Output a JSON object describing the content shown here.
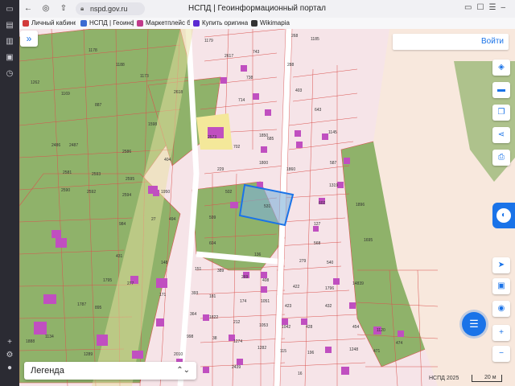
{
  "browser": {
    "url": "nspd.gov.ru",
    "page_title": "НСПД | Геоинформационный портал",
    "bookmarks": [
      {
        "label": "Личный кабинет",
        "color": "#d23a3a"
      },
      {
        "label": "НСПД | Геоинфор",
        "color": "#3a6ad2"
      },
      {
        "label": "Маркетплейс бра",
        "color": "#c03a8a"
      },
      {
        "label": "Купить оригинал",
        "color": "#5a2ad2"
      },
      {
        "label": "Wikimapia",
        "color": "#333333"
      }
    ]
  },
  "map": {
    "login_label": "Войти",
    "legend_label": "Легенда",
    "attribution": "НСПД 2025",
    "scale_label": "20 м",
    "selected_parcel_label": "531",
    "colors": {
      "parcel_fill": "#f6e4e8",
      "parcel_border": "#d9534f",
      "green_area": "#8fb26a",
      "building": "#c04fc0",
      "selected_border": "#1a73e8",
      "road": "#ffffff"
    },
    "parcel_labels": [
      "268",
      "1185",
      "1179",
      "2617",
      "743",
      "1178",
      "1188",
      "288",
      "1173",
      "738",
      "1262",
      "1169",
      "887",
      "2618",
      "403",
      "714",
      "643",
      "1598",
      "1850",
      "2573",
      "702",
      "685",
      "1145",
      "2486",
      "2487",
      "2586",
      "404",
      "1800",
      "1860",
      "587",
      "2581",
      "2593",
      "2590",
      "2592",
      "2595",
      "229",
      "1319",
      "2594",
      "1950",
      "502",
      "602",
      "27",
      "494",
      "599",
      "127",
      "1896",
      "984",
      "604",
      "568",
      "1695",
      "431",
      "136",
      "279",
      "540",
      "148",
      "151",
      "389",
      "269",
      "408",
      "422",
      "1796",
      "1795",
      "277",
      "171",
      "393",
      "181",
      "174",
      "1051",
      "423",
      "432",
      "14839",
      "1787",
      "895",
      "364",
      "1822",
      "212",
      "1053",
      "1042",
      "428",
      "454",
      "1120",
      "1134",
      "998",
      "38",
      "1274",
      "1282",
      "115",
      "196",
      "1248",
      "471",
      "474",
      "1289",
      "2439",
      "16",
      "2010",
      "1888"
    ]
  }
}
